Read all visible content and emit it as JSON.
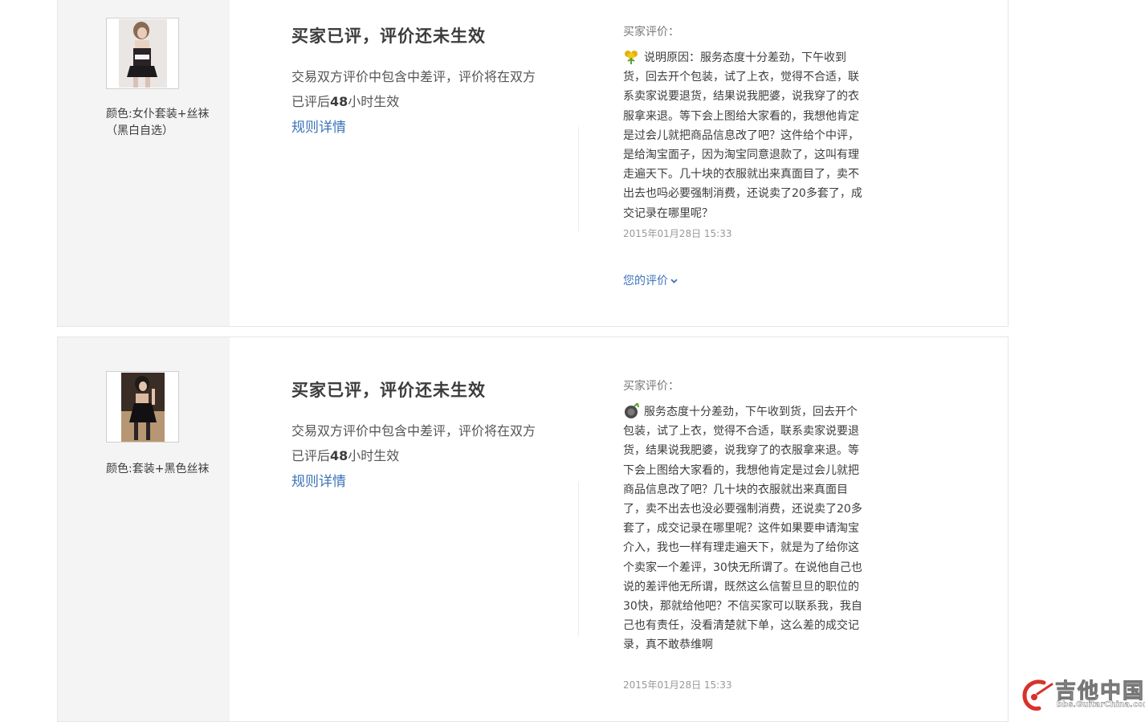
{
  "orders": [
    {
      "color_option": "颜色:女仆套装+丝袜（黑白自选）",
      "status_title": "买家已评，评价还未生效",
      "status_desc_prefix": "交易双方评价中包含中差评，评价将在双方已评后",
      "status_desc_hours": "48",
      "status_desc_suffix": "小时生效",
      "rule_link": "规则详情",
      "review_label": "买家评价：",
      "review_text": "说明原因：服务态度十分差劲，下午收到货，回去开个包装，试了上衣，觉得不合适，联系卖家说要退货，结果说我肥婆，说我穿了的衣服拿来退。等下会上图给大家看的，我想他肯定是过会儿就把商品信息改了吧？这件给个中评，是给淘宝面子，因为淘宝同意退款了，这叫有理走遍天下。几十块的衣服就出来真面目了，卖不出去也吗必要强制消费，还说卖了20多套了，成交记录在哪里呢？",
      "review_date": "2015年01月28日 15:33",
      "your_review": "您的评价"
    },
    {
      "color_option": "颜色:套装+黑色丝袜",
      "status_title": "买家已评，评价还未生效",
      "status_desc_prefix": "交易双方评价中包含中差评，评价将在双方已评后",
      "status_desc_hours": "48",
      "status_desc_suffix": "小时生效",
      "rule_link": "规则详情",
      "review_label": "买家评价：",
      "review_text": "服务态度十分差劲，下午收到货，回去开个包装，试了上衣，觉得不合适，联系卖家说要退货，结果说我肥婆，说我穿了的衣服拿来退。等下会上图给大家看的，我想他肯定是过会儿就把商品信息改了吧？几十块的衣服就出来真面目了，卖不出去也没必要强制消费，还说卖了20多套了，成交记录在哪里呢？这件如果要申请淘宝介入，我也一样有理走遍天下，就是为了给你这个卖家一个差评，30快无所谓了。在说他自己也说的差评他无所谓，既然这么信誓旦旦的职位的30快，那就给他吧？不信买家可以联系我，我自己也有责任，没看清楚就下单，这么差的成交记录，真不敢恭维啊",
      "review_date": "2015年01月28日 15:33"
    }
  ],
  "watermark": {
    "logo_text": "吉他中国",
    "logo_url": "bbs.GuitarChina.com"
  }
}
